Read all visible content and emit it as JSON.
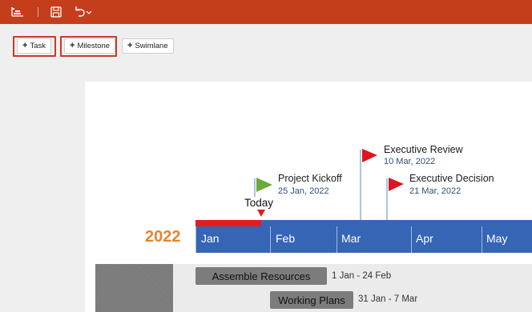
{
  "toolbar": {
    "icons": [
      "timeline-view-icon",
      "save-icon",
      "undo-icon",
      "chevron-down-icon"
    ],
    "colors": {
      "bar": "#c43e1c"
    }
  },
  "add_buttons": [
    {
      "plus": "+",
      "label": "Task"
    },
    {
      "plus": "+",
      "label": "Milestone"
    },
    {
      "plus": "+",
      "label": "Swimlane"
    }
  ],
  "milestones": [
    {
      "title": "Project Kickoff",
      "date": "25 Jan, 2022",
      "flag_color": "#6aaa3c"
    },
    {
      "title": "Executive Review",
      "date": "10 Mar, 2022",
      "flag_color": "#e0141e"
    },
    {
      "title": "Executive Decision",
      "date": "21 Mar, 2022",
      "flag_color": "#e0141e"
    }
  ],
  "today": {
    "label": "Today",
    "color": "#e51c1c"
  },
  "timescale": {
    "year": "2022",
    "months": [
      "Jan",
      "Feb",
      "Mar",
      "Apr",
      "May"
    ],
    "colors": {
      "band": "#3565b4",
      "year": "#e8822e"
    }
  },
  "tasks": [
    {
      "label": "Assemble Resources",
      "dates": "1 Jan - 24 Feb"
    },
    {
      "label": "Working Plans",
      "dates": "31 Jan - 7 Mar"
    }
  ]
}
